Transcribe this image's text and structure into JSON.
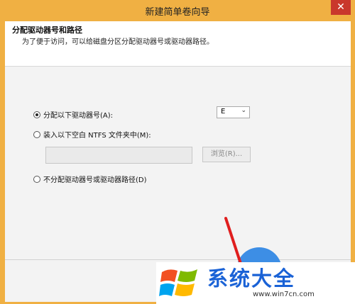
{
  "window": {
    "title": "新建简单卷向导",
    "close_glyph": "✕"
  },
  "header": {
    "title": "分配驱动器号和路径",
    "description": "为了便于访问，可以给磁盘分区分配驱动器号或驱动器路径。"
  },
  "options": [
    {
      "label": "分配以下驱动器号(A):",
      "checked": true
    },
    {
      "label": "装入以下空白 NTFS 文件夹中(M):",
      "checked": false
    },
    {
      "label": "不分配驱动器号或驱动器路径(D)",
      "checked": false
    }
  ],
  "drive_select": {
    "value": "E"
  },
  "path_input": {
    "value": ""
  },
  "browse_button": {
    "label": "浏览(R)..."
  },
  "watermark": {
    "title": "系统大全",
    "url": "www.win7cn.com"
  },
  "colors": {
    "frame": "#f0b043",
    "client": "#f3f3f3",
    "arrow": "#e01e1e",
    "watermark_text": "#1a62d6"
  }
}
